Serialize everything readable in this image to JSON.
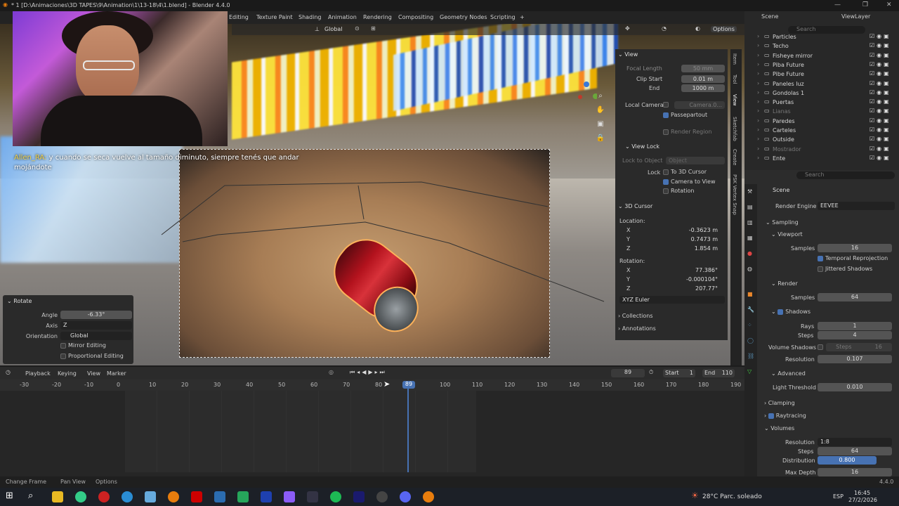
{
  "window": {
    "title": "* 1 [D:\\Animaciones\\3D TAPES\\9\\Animation\\1\\13-18\\4\\1.blend] - Blender 4.4.0",
    "min": "—",
    "max": "❐",
    "close": "✕"
  },
  "menu_tabs": [
    "Editing",
    "Texture Paint",
    "Shading",
    "Animation",
    "Rendering",
    "Compositing",
    "Geometry Nodes",
    "Scripting",
    "+"
  ],
  "viewport_header": {
    "orientation": "Global",
    "options": "Options"
  },
  "chat": {
    "user": "Allen_RA:",
    "message": " y cuando se seca vuelve al tamaño diminuto, siempre tenés que andar mojándote"
  },
  "rotate_panel": {
    "title": "Rotate",
    "angle_label": "Angle",
    "angle": "-6.33°",
    "axis_label": "Axis",
    "axis": "Z",
    "orientation_label": "Orientation",
    "orientation": "Global",
    "mirror": "Mirror Editing",
    "proportional": "Proportional Editing"
  },
  "npanel": {
    "view": {
      "title": "View",
      "focal_label": "Focal Length",
      "focal": "50 mm",
      "clip_start_label": "Clip Start",
      "clip_start": "0.01 m",
      "end_label": "End",
      "end": "1000 m",
      "local_camera": "Local Camera",
      "camera_field": "Camera.0...",
      "passepartout": "Passepartout",
      "render_region": "Render Region"
    },
    "view_lock": {
      "title": "View Lock",
      "lock_to_object": "Lock to Object",
      "object": "Object",
      "lock": "Lock",
      "to_3d_cursor": "To 3D Cursor",
      "camera_to_view": "Camera to View",
      "rotation": "Rotation"
    },
    "cursor": {
      "title": "3D Cursor",
      "location": "Location:",
      "lx": "-0.3623 m",
      "ly": "0.7473 m",
      "lz": "1.854 m",
      "rotation": "Rotation:",
      "rx": "77.386°",
      "ry": "-0.000104°",
      "rz": "207.77°",
      "mode": "XYZ Euler",
      "X": "X",
      "Y": "Y",
      "Z": "Z"
    },
    "collections": "Collections",
    "annotations": "Annotations"
  },
  "side_tabs": [
    "Item",
    "Tool",
    "View",
    "Sketchfab",
    "Create",
    "PSK Vertex Snap"
  ],
  "outliner": {
    "scene": "Scene",
    "view_layer": "ViewLayer",
    "search": "Search",
    "rows": [
      {
        "name": "Particles",
        "dim": false
      },
      {
        "name": "Techo",
        "dim": false
      },
      {
        "name": "Fisheye mirror",
        "dim": false
      },
      {
        "name": "Piba Future",
        "dim": false
      },
      {
        "name": "Pibe Future",
        "dim": false
      },
      {
        "name": "Paneles luz",
        "dim": false
      },
      {
        "name": "Gondolas 1",
        "dim": false
      },
      {
        "name": "Puertas",
        "dim": false
      },
      {
        "name": "Lianas",
        "dim": true
      },
      {
        "name": "Paredes",
        "dim": false
      },
      {
        "name": "Carteles",
        "dim": false
      },
      {
        "name": "Outside",
        "dim": false
      },
      {
        "name": "Mostrador",
        "dim": true
      },
      {
        "name": "Ente",
        "dim": false
      }
    ]
  },
  "properties": {
    "search": "Search",
    "scene": "Scene",
    "render_engine_label": "Render Engine",
    "render_engine": "EEVEE",
    "sampling": "Sampling",
    "viewport": "Viewport",
    "vp_samples_label": "Samples",
    "vp_samples": "16",
    "temporal": "Temporal Reprojection",
    "jittered": "Jittered Shadows",
    "render": "Render",
    "r_samples_label": "Samples",
    "r_samples": "64",
    "shadows": "Shadows",
    "rays_label": "Rays",
    "rays": "1",
    "steps_label": "Steps",
    "steps": "4",
    "vol_shadows": "Volume Shadows",
    "vs_steps_label": "Steps",
    "vs_steps": "16",
    "resolution_label": "Resolution",
    "resolution": "0.107",
    "advanced": "Advanced",
    "light_threshold_label": "Light Threshold",
    "light_threshold": "0.010",
    "clamping": "Clamping",
    "raytracing": "Raytracing",
    "volumes": "Volumes",
    "vol_res_label": "Resolution",
    "vol_res": "1:8",
    "vol_steps_label": "Steps",
    "vol_steps": "64",
    "distribution_label": "Distribution",
    "distribution": "0.800",
    "max_depth_label": "Max Depth",
    "max_depth": "16"
  },
  "timeline": {
    "playback": "Playback",
    "keying": "Keying",
    "view": "View",
    "marker": "Marker",
    "current": "89",
    "start_label": "Start",
    "start": "1",
    "end_label": "End",
    "end": "110",
    "playhead": "89",
    "ticks": [
      "-30",
      "-20",
      "-10",
      "0",
      "10",
      "20",
      "30",
      "40",
      "50",
      "60",
      "70",
      "80",
      "100",
      "110",
      "120",
      "130",
      "140",
      "150",
      "160",
      "170",
      "180",
      "190"
    ]
  },
  "status": {
    "change_frame": "Change Frame",
    "pan_view": "Pan View",
    "options": "Options",
    "version": "4.4.0"
  },
  "taskbar": {
    "weather": "28°C Parc. soleado",
    "lang": "ESP",
    "time": "16:45",
    "date": "27/2/2026"
  }
}
